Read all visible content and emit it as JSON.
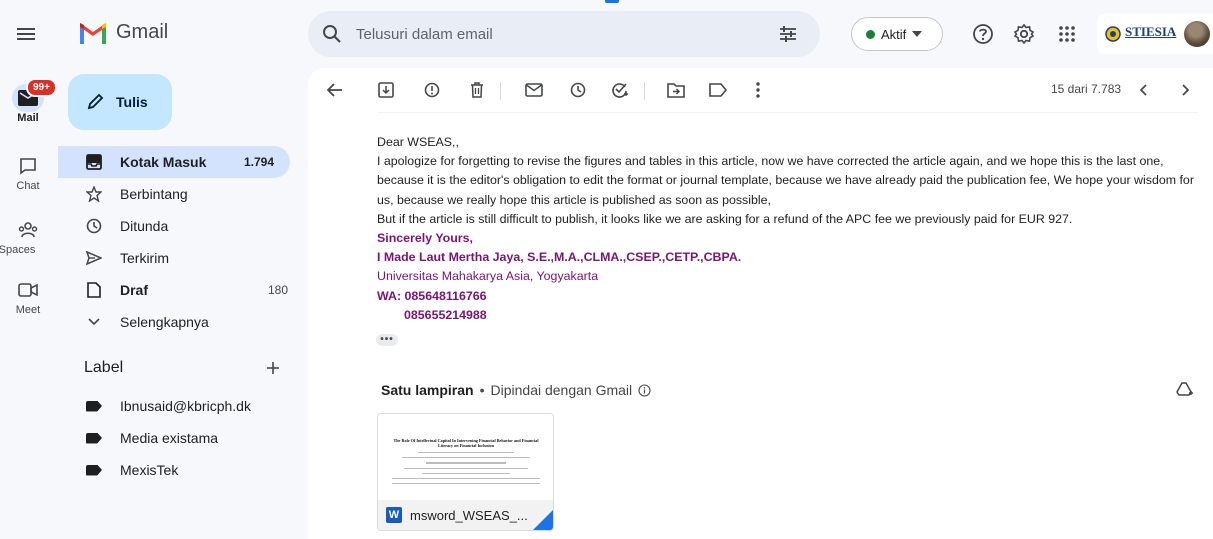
{
  "header": {
    "app_name": "Gmail",
    "search_placeholder": "Telusuri dalam email",
    "status_label": "Aktif",
    "status_color": "#188038",
    "account_org": "STIESIA",
    "brand_colors": {
      "red": "#ea4335",
      "blue": "#4285f4",
      "green": "#34a853",
      "yellow": "#fbbc04"
    }
  },
  "rail": {
    "mail": {
      "label": "Mail",
      "badge": "99+"
    },
    "chat": {
      "label": "Chat"
    },
    "spaces": {
      "label": "Spaces"
    },
    "meet": {
      "label": "Meet"
    }
  },
  "nav": {
    "compose_label": "Tulis",
    "items": [
      {
        "label": "Kotak Masuk",
        "count": "1.794",
        "icon": "inbox-icon"
      },
      {
        "label": "Berbintang",
        "count": "",
        "icon": "star-icon"
      },
      {
        "label": "Ditunda",
        "count": "",
        "icon": "clock-icon"
      },
      {
        "label": "Terkirim",
        "count": "",
        "icon": "send-icon"
      },
      {
        "label": "Draf",
        "count": "180",
        "icon": "draft-icon"
      },
      {
        "label": "Selengkapnya",
        "count": "",
        "icon": "chevron-down-icon"
      }
    ],
    "labels_heading": "Label",
    "labels": [
      "Ibnusaid@kbricph.dk",
      "Media existama",
      "MexisTek"
    ]
  },
  "toolbar": {
    "pager": "15 dari 7.783"
  },
  "email": {
    "greeting": "Dear WSEAS,,",
    "paragraph1": "I apologize for forgetting to revise the figures and tables in this article, now we have corrected the article again, and we hope this is the last one, because it is the editor's obligation to edit the format or journal template, because we have already paid the publication fee, We hope your wisdom for us, because we really hope this article is published as soon as possible,",
    "paragraph2": "But if the article is still difficult to publish, it looks like we are asking for a refund of the APC fee we previously paid for EUR 927.",
    "closing": "Sincerely Yours,",
    "signature_name": "I Made Laut Mertha Jaya, S.E.,M.A.,CLMA.,CSEP.,CETP.,CBPA.",
    "signature_org": "Universitas Mahakarya Asia, Yogyakarta",
    "signature_wa": "WA: 085648116766",
    "signature_wa2": "085655214988",
    "signature_color": "#7a1377"
  },
  "attachments": {
    "heading": "Satu lampiran",
    "scan_note": "Dipindai dengan Gmail",
    "file_name": "msword_WSEAS_...",
    "preview_title": "The Role Of Intellectual Capital In Intervening Financial Behavior and Financial Literacy on Financial Inclusion"
  }
}
